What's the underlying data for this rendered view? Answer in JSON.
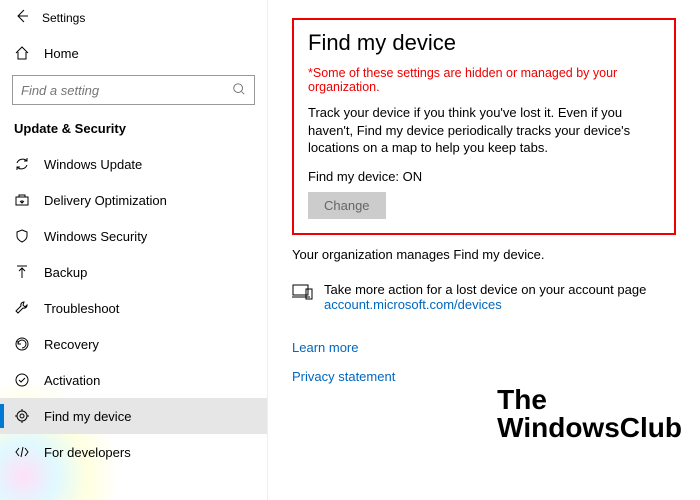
{
  "header": {
    "title": "Settings"
  },
  "home": {
    "label": "Home"
  },
  "search": {
    "placeholder": "Find a setting"
  },
  "category": {
    "label": "Update & Security"
  },
  "nav": {
    "items": [
      {
        "label": "Windows Update"
      },
      {
        "label": "Delivery Optimization"
      },
      {
        "label": "Windows Security"
      },
      {
        "label": "Backup"
      },
      {
        "label": "Troubleshoot"
      },
      {
        "label": "Recovery"
      },
      {
        "label": "Activation"
      },
      {
        "label": "Find my device"
      },
      {
        "label": "For developers"
      }
    ]
  },
  "main": {
    "title": "Find my device",
    "warning": "*Some of these settings are hidden or managed by your organization.",
    "description": "Track your device if you think you've lost it. Even if you haven't, Find my device periodically tracks your device's locations on a map to help you keep tabs.",
    "status_label": "Find my device: ON",
    "change_button": "Change",
    "org_note": "Your organization manages Find my device.",
    "action_text": "Take more action for a lost device on your account page",
    "action_link": "account.microsoft.com/devices",
    "learn_more": "Learn more",
    "privacy": "Privacy statement"
  },
  "watermark": {
    "line1": "The",
    "line2": "WindowsClub"
  }
}
